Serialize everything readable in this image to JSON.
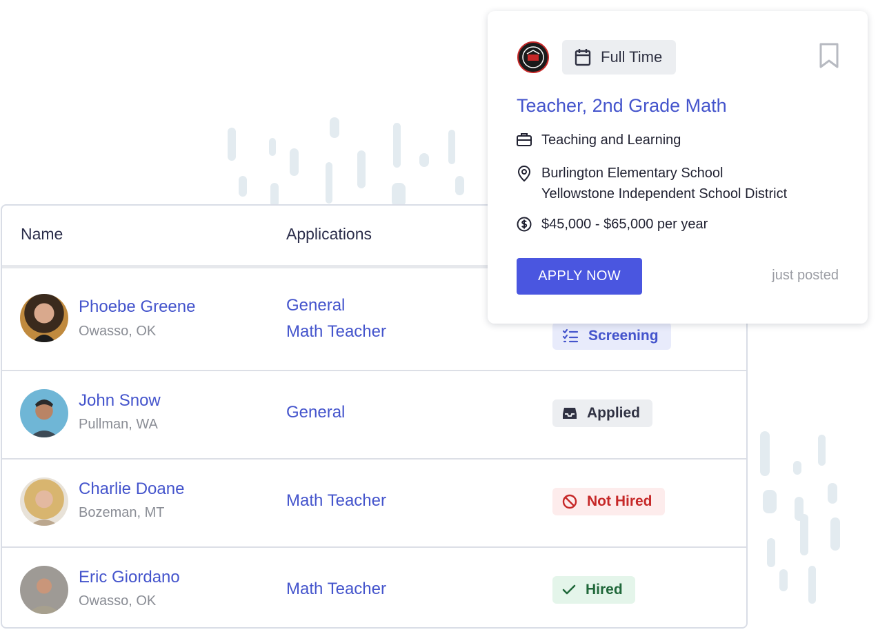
{
  "table": {
    "headers": {
      "name": "Name",
      "applications": "Applications"
    },
    "rows": [
      {
        "name": "Phoebe Greene",
        "location": "Owasso, OK",
        "applications": [
          "General",
          "Math Teacher"
        ],
        "status": "Screening",
        "status_icon": "list-check-icon"
      },
      {
        "name": "John Snow",
        "location": "Pullman, WA",
        "applications": [
          "General"
        ],
        "status": "Applied",
        "status_icon": "inbox-icon"
      },
      {
        "name": "Charlie Doane",
        "location": "Bozeman, MT",
        "applications": [
          "Math Teacher"
        ],
        "status": "Not Hired",
        "status_icon": "ban-icon"
      },
      {
        "name": "Eric Giordano",
        "location": "Owasso, OK",
        "applications": [
          "Math Teacher"
        ],
        "status": "Hired",
        "status_icon": "check-icon"
      }
    ]
  },
  "job": {
    "type": "Full Time",
    "title": "Teacher, 2nd Grade Math",
    "department": "Teaching and Learning",
    "school": "Burlington Elementary School",
    "district": "Yellowstone Independent School District",
    "salary": "$45,000 - $65,000 per year",
    "apply_label": "APPLY NOW",
    "posted": "just posted"
  },
  "colors": {
    "accent": "#4a56e0",
    "link": "#4454cc",
    "screening": "#e8ebfb",
    "applied": "#eceef1",
    "not_hired": "#fdecec",
    "hired": "#e4f5ea"
  }
}
